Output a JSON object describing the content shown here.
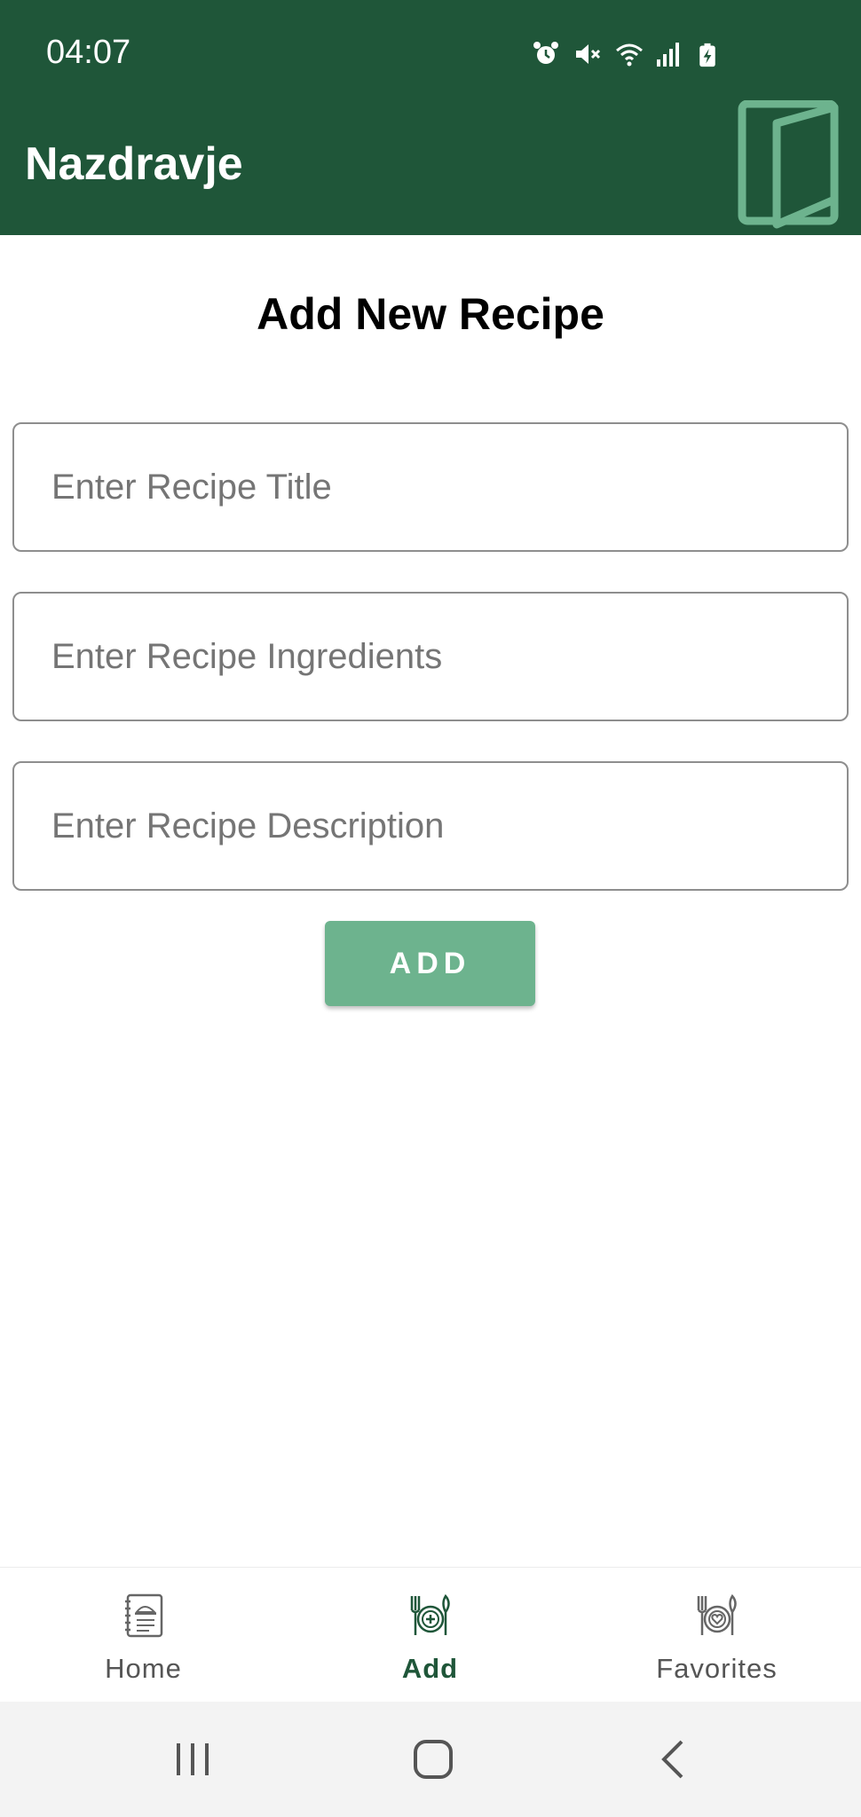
{
  "status_bar": {
    "time": "04:07",
    "icons": [
      "alarm-icon",
      "mute-icon",
      "wifi-icon",
      "signal-icon",
      "battery-charging-icon"
    ]
  },
  "app_bar": {
    "title": "Nazdravje",
    "logo_icon": "book-logo-icon"
  },
  "page": {
    "heading": "Add New Recipe",
    "fields": {
      "title_placeholder": "Enter Recipe Title",
      "ingredients_placeholder": "Enter Recipe Ingredients",
      "description_placeholder": "Enter Recipe Description"
    },
    "add_label": "ADD"
  },
  "bottom_nav": {
    "items": [
      {
        "label": "Home",
        "icon": "recipe-book-icon",
        "active": false
      },
      {
        "label": "Add",
        "icon": "plate-plus-icon",
        "active": true
      },
      {
        "label": "Favorites",
        "icon": "plate-heart-icon",
        "active": false
      }
    ]
  },
  "system_nav": {
    "icons": [
      "recents-icon",
      "home-icon",
      "back-icon"
    ]
  },
  "colors": {
    "primary": "#1f5639",
    "button": "#6db38e",
    "logo_stroke": "#6db38e"
  }
}
